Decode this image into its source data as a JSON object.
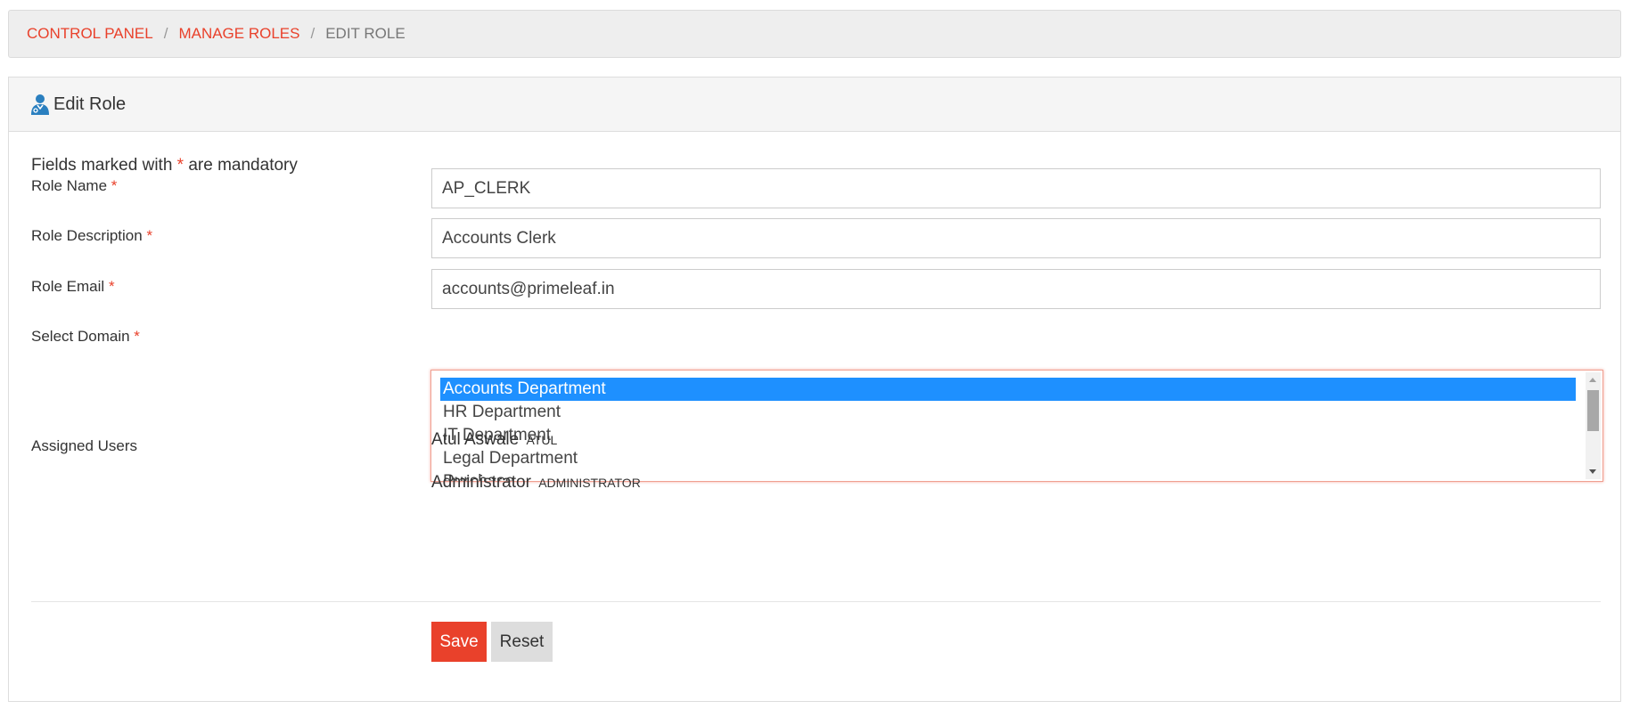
{
  "breadcrumb": {
    "items": [
      "CONTROL PANEL",
      "MANAGE ROLES"
    ],
    "active": "EDIT ROLE",
    "separator": "/"
  },
  "panel": {
    "title": "Edit Role",
    "icon": "user-role-icon"
  },
  "form": {
    "mandatory_prefix": "Fields marked with",
    "mandatory_mark": "*",
    "mandatory_suffix": "are mandatory",
    "role_name": {
      "label": "Role Name",
      "value": "AP_CLERK"
    },
    "role_description": {
      "label": "Role Description",
      "value": "Accounts Clerk"
    },
    "role_email": {
      "label": "Role Email",
      "value": "accounts@primeleaf.in"
    },
    "domain": {
      "label": "Select Domain",
      "options": [
        "Accounts Department",
        "HR Department",
        "IT Department",
        "Legal Department",
        "Purchase"
      ],
      "selected": "Accounts Department"
    },
    "assigned_users": {
      "label": "Assigned Users",
      "users": [
        {
          "name": "Atul Aswale",
          "login": "ATUL"
        },
        {
          "name": "Administrator",
          "login": "ADMINISTRATOR"
        }
      ]
    }
  },
  "actions": {
    "save": "Save",
    "reset": "Reset"
  },
  "colors": {
    "accent": "#e9412b",
    "selection": "#1e90ff",
    "icon": "#2a7fbf"
  }
}
